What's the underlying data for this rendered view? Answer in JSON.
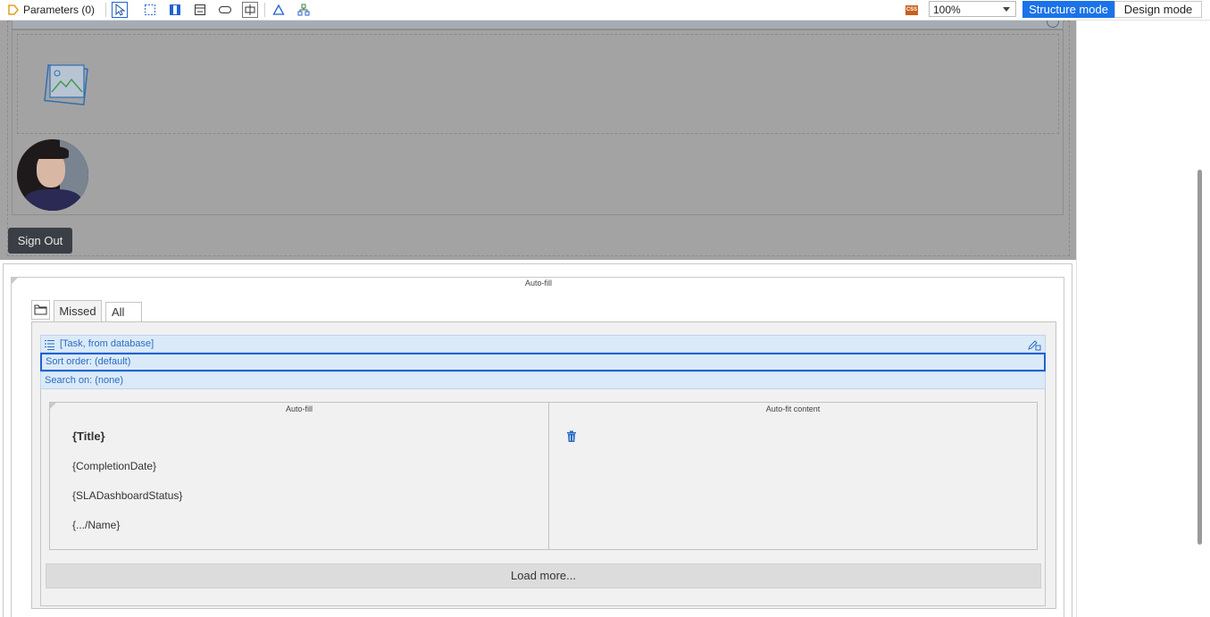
{
  "toolbar": {
    "parameters_label": "Parameters (0)",
    "zoom_value": "100%",
    "css_badge": "CSS",
    "structure_mode_label": "Structure mode",
    "design_mode_label": "Design mode"
  },
  "header": {
    "sign_out_label": "Sign Out"
  },
  "autofill_label": "Auto-fill",
  "tabs": {
    "missed_label": "Missed",
    "all_label": "All"
  },
  "list_view": {
    "source_label": "[Task, from database]",
    "sort_order_label": "Sort order: (default)",
    "search_on_label": "Search on: (none)"
  },
  "template": {
    "left_column_label": "Auto-fill",
    "right_column_label": "Auto-fit content",
    "title_field": "{Title}",
    "completion_date_field": "{CompletionDate}",
    "sla_status_field": "{SLADashboardStatus}",
    "name_field": "{.../Name}"
  },
  "load_more_label": "Load more...",
  "colors": {
    "accent": "#1a73e8",
    "selected_border": "#1f62d6",
    "overlay": "#a3a3a3",
    "button_dark": "#3a3f46",
    "row_blue": "#dbeaf8"
  }
}
